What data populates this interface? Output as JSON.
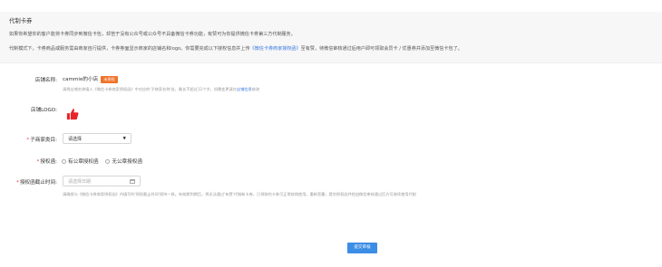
{
  "notice": {
    "title": "代制卡券",
    "line1": "如果你希望你的客户能将卡券同步到微信卡包，却苦于没有公众号或公众号不具备微信卡券功能，有赞可为你提供微信卡券第三方代制服务。",
    "line2_pre": "代制模式下，卡券商品或服务需由商家自行提供，卡券券面显示商家的店铺名和logo。你需要完成以下授权信息并上传",
    "line2_link": "《微信卡券商家授权函》",
    "line2_post": "至有赞，待微信审核通过后用户即可领取会员卡 / 优惠券并添加至微信卡包了。"
  },
  "form": {
    "shop_name_label": "店铺名称:",
    "shop_name_value": "cammie的小店",
    "shop_badge": "未授权",
    "shop_hint_pre": "请将店铺名称填入《微信卡券商家授权函》中对应的'子商家名称'处，最长不超过12个字，如需变更请在",
    "shop_hint_link": "店铺信息",
    "shop_hint_post": "修改",
    "logo_label": "店铺LOGO:",
    "logo_icon": "thumbs-up-icon",
    "category_label": "子商家类目:",
    "category_value": "请选择",
    "auth_label": "授权函:",
    "auth_options": [
      "有公章授权函",
      "无公章授权函"
    ],
    "deadline_label": "授权函截止时间:",
    "deadline_placeholder": "请选择日期",
    "deadline_hint": "请确保与《微信卡券商家授权函》内填写的'授权截止时间'保持一致。有效期到期后，将无法通过'有赞'代制新卡券，已领取的卡券可正常核销使用。重新签署，提交授权函并经由微信审核通过后方可继续使用代制",
    "submit_label": "提交审核"
  },
  "colors": {
    "accent": "#3b8de5",
    "link": "#3a7be0",
    "badge": "#f0732a",
    "required": "#e4393c",
    "thumb": "#e8242a"
  }
}
